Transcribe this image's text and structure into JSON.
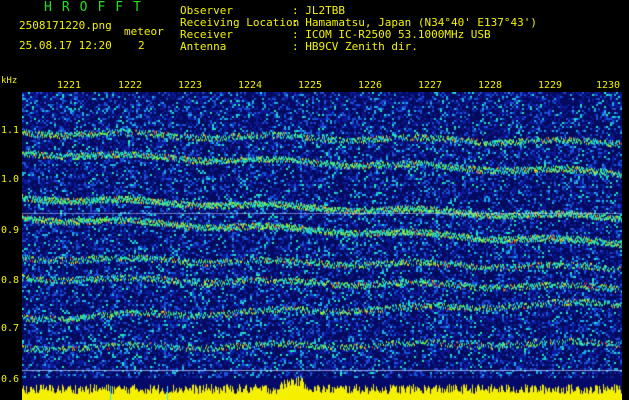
{
  "header": {
    "brand": "HROFFT",
    "filename": "2508171220.png",
    "timestamp": "25.08.17 12:20",
    "mode_label": "meteor",
    "mode_count": "2",
    "info": [
      {
        "label": "Observer",
        "value": ": JL2TBB"
      },
      {
        "label": "Receiving Location",
        "value": ": Hamamatsu, Japan (N34°40' E137°43')"
      },
      {
        "label": "Receiver",
        "value": ": ICOM IC-R2500 53.1000MHz USB"
      },
      {
        "label": "Antenna",
        "value": ": HB9CV Zenith dir."
      }
    ]
  },
  "axis": {
    "unit": "kHz",
    "x_ticks": [
      "1221",
      "1222",
      "1223",
      "1224",
      "1225",
      "1226",
      "1227",
      "1228",
      "1229",
      "1230"
    ],
    "y_ticks": [
      "1.1",
      "1.0",
      "0.9",
      "0.8",
      "0.7",
      "0.6"
    ]
  },
  "colors": {
    "text_green": "#22e01c",
    "text_yellow": "#f2f200",
    "background": "#000000",
    "noise_floor": "#0a0f7a",
    "level_bar": "#f5f000"
  }
}
